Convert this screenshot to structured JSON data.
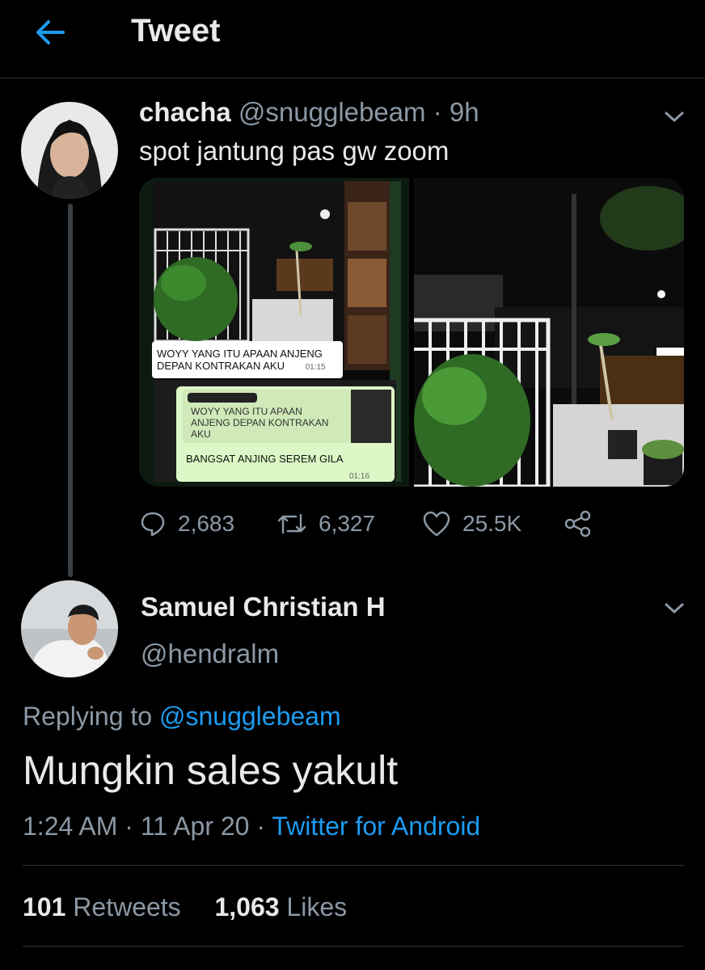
{
  "header": {
    "title": "Tweet"
  },
  "parent_tweet": {
    "name": "chacha",
    "handle": "@snugglebeam",
    "time": "· 9h",
    "text": "spot jantung pas gw zoom",
    "media": {
      "chat1_line1": "WOYY YANG ITU APAAN ANJENG",
      "chat1_line2": "DEPAN KONTRAKAN AKU",
      "chat1_time": "01:15",
      "quote_line1": "WOYY YANG ITU APAAN",
      "quote_line2": "ANJENG DEPAN KONTRAKAN",
      "quote_line3": "AKU",
      "chat2_text": "BANGSAT ANJING SEREM GILA",
      "chat2_time": "01:16"
    },
    "replies": "2,683",
    "retweets": "6,327",
    "likes": "25.5K"
  },
  "main_tweet": {
    "name": "Samuel Christian H",
    "handle": "@hendralm",
    "replying_prefix": "Replying to ",
    "replying_to": "@snugglebeam",
    "text": "Mungkin sales yakult",
    "time": "1:24 AM",
    "date": "11 Apr 20",
    "source": "Twitter for Android",
    "retweet_count": "101",
    "retweet_label": "Retweets",
    "like_count": "1,063",
    "like_label": "Likes"
  },
  "colors": {
    "accent": "#1d9bf0",
    "muted": "#8b98a5",
    "background": "#000000"
  },
  "icons": [
    "back-arrow-icon",
    "chevron-down-icon",
    "reply-icon",
    "retweet-icon",
    "like-icon",
    "share-icon"
  ]
}
